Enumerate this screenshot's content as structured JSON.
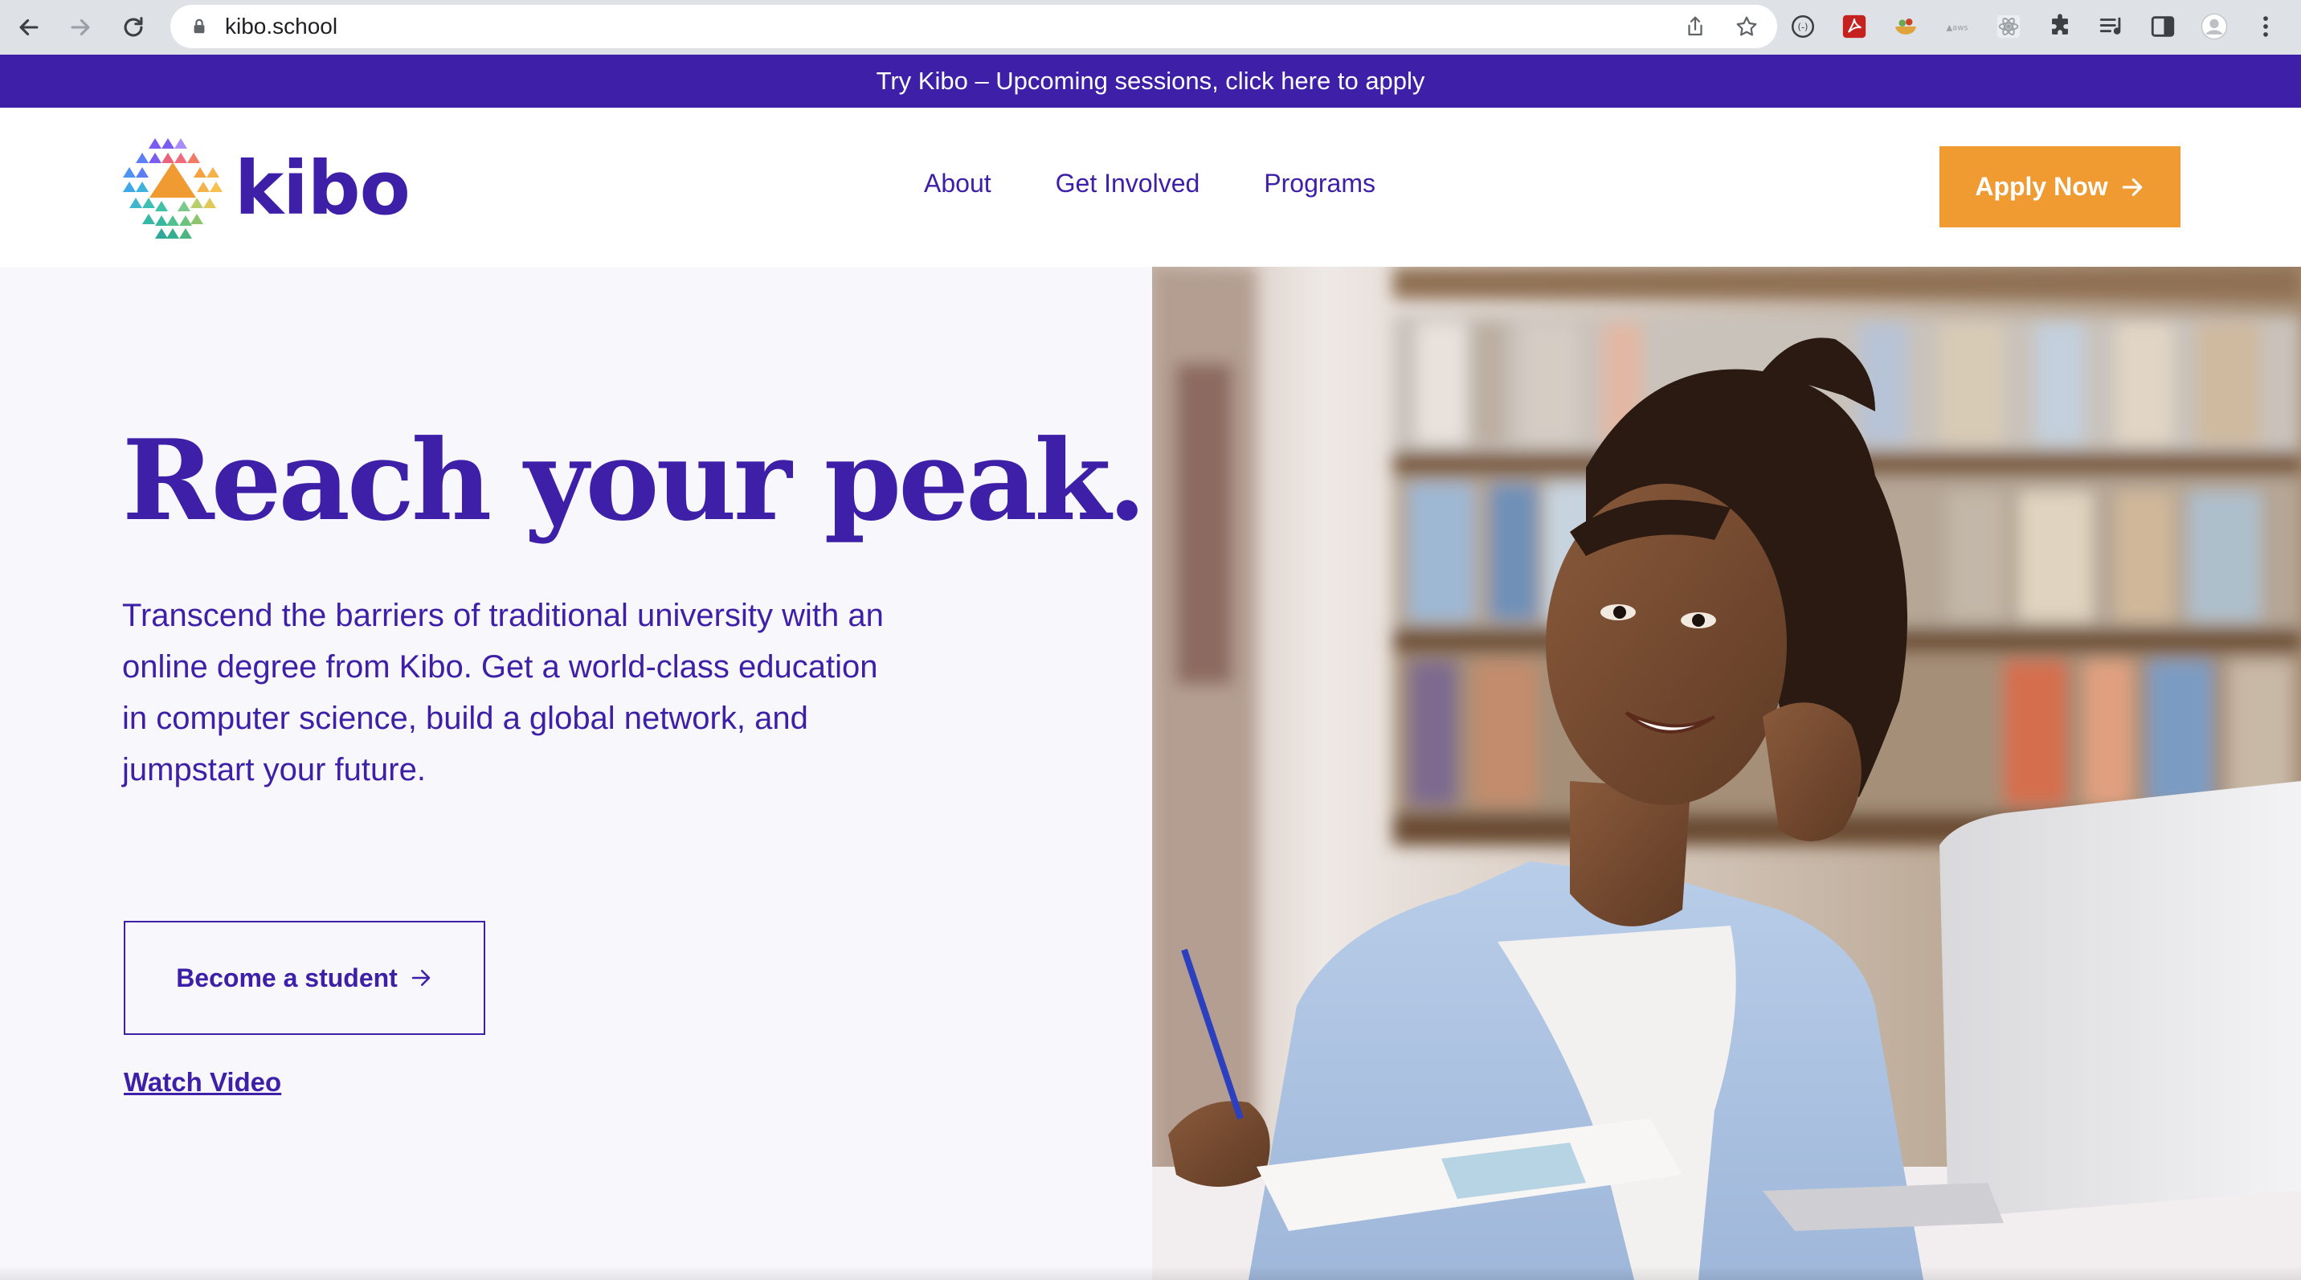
{
  "browser": {
    "url": "kibo.school"
  },
  "announcement": {
    "text": "Try Kibo – Upcoming sessions, click here to apply"
  },
  "header": {
    "logo_text": "kibo",
    "nav": [
      "About",
      "Get Involved",
      "Programs"
    ],
    "cta_label": "Apply Now"
  },
  "hero": {
    "title": "Reach your peak.",
    "subtitle_lines": [
      "Transcend the barriers of traditional university with an",
      "online degree from Kibo. Get a world-class education",
      "in computer science, build a global network, and",
      "jumpstart your future."
    ],
    "primary_button": "Become a student",
    "secondary_link": "Watch Video"
  },
  "colors": {
    "brand_purple": "#3d1fa8",
    "accent_orange": "#f09a32",
    "hero_bg": "#f8f7fc"
  }
}
